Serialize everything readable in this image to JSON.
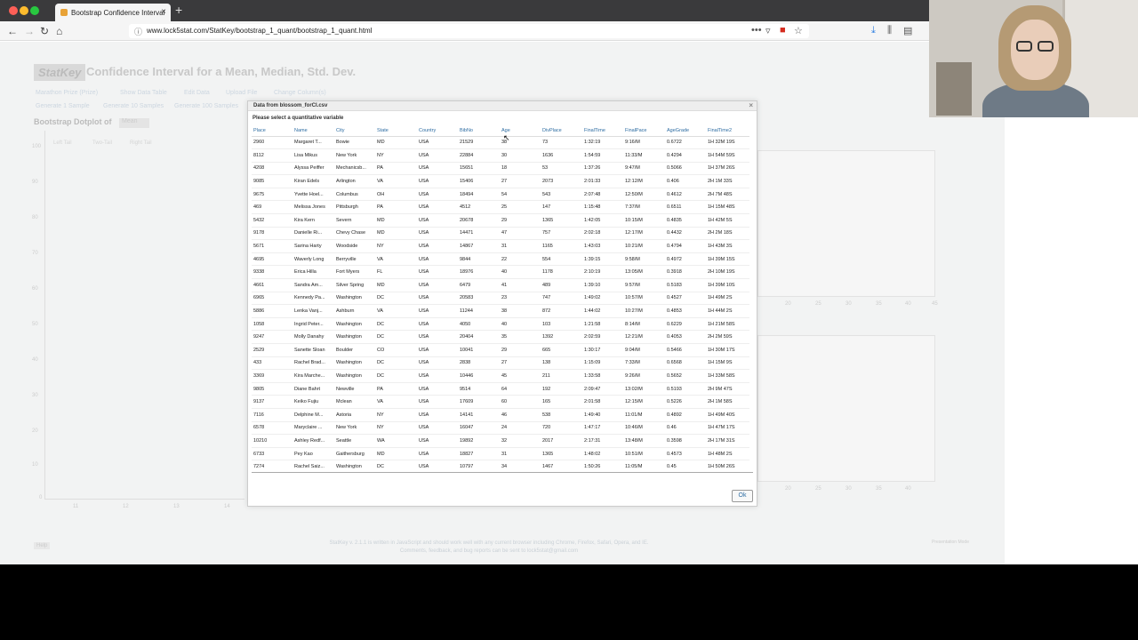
{
  "browser": {
    "tab_title": "Bootstrap Confidence Interval",
    "tab_close": "×",
    "new_tab": "+",
    "url": "www.lock5stat.com/StatKey/bootstrap_1_quant/bootstrap_1_quant.html",
    "icons": [
      "back-arrow-icon",
      "forward-arrow-icon",
      "reload-icon",
      "home-icon",
      "info-icon",
      "more-icon",
      "pocket-icon",
      "flag-icon",
      "star-icon",
      "download-icon",
      "library-icon",
      "sidebar-icon"
    ]
  },
  "page": {
    "logo": "StatKey",
    "title": "Confidence Interval for a Mean, Median, Std. Dev.",
    "menu_row1": [
      "Marathon Prize (Prize)",
      "Show Data Table",
      "Edit Data",
      "Upload File",
      "Change Column(s)"
    ],
    "menu_row2": [
      "Generate 1 Sample",
      "Generate 10 Samples",
      "Generate 100 Samples"
    ],
    "subtitle": "Bootstrap Dotplot of",
    "stat_select": "Mean",
    "radios": [
      "Left Tail",
      "Two-Tail",
      "Right Tail"
    ],
    "y_ticks": [
      "100",
      "90",
      "80",
      "70",
      "60",
      "50",
      "40",
      "30",
      "20",
      "10",
      "0"
    ],
    "x_ticks": [
      "11",
      "12",
      "13",
      "14"
    ],
    "side_x_ticks": [
      "20",
      "25",
      "30",
      "35",
      "40",
      "45"
    ],
    "footer_line1": "StatKey v. 2.1.1 is written in JavaScript and should work well with any current browser including Chrome, Firefox, Safari, Opera, and IE.",
    "footer_line2": "Comments, feedback, and bug reports can be sent to lock5stat@gmail.com",
    "help": "Help",
    "presentation": "Presentation Mode"
  },
  "modal": {
    "title": "Data from blossom_forCI.csv",
    "close": "×",
    "subtitle": "Please select a quantitative variable",
    "ok": "Ok",
    "columns": [
      "Place",
      "Name",
      "City",
      "State",
      "Country",
      "BibNo",
      "Age",
      "DivPlace",
      "FinalTime",
      "FinalPace",
      "AgeGrade",
      "FinalTime2"
    ],
    "rows": [
      [
        "2960",
        "Margaret T...",
        "Bowie",
        "MD",
        "USA",
        "21529",
        "38",
        "73",
        "1:32:19",
        "9:16/M",
        "0.6722",
        "1H 32M 19S"
      ],
      [
        "8112",
        "Lisa Mikus",
        "New York",
        "NY",
        "USA",
        "22884",
        "30",
        "1636",
        "1:54:59",
        "11:33/M",
        "0.4294",
        "1H 54M 59S"
      ],
      [
        "4208",
        "Alyssa Peiffer",
        "Mechanicsb...",
        "PA",
        "USA",
        "15651",
        "18",
        "53",
        "1:37:26",
        "9:47/M",
        "0.5066",
        "1H 37M 26S"
      ],
      [
        "9085",
        "Kiran Edels",
        "Arlington",
        "VA",
        "USA",
        "15406",
        "27",
        "2073",
        "2:01:33",
        "12:12/M",
        "0.406",
        "2H 1M 33S"
      ],
      [
        "9675",
        "Yvette Hoel...",
        "Columbus",
        "OH",
        "USA",
        "18494",
        "54",
        "543",
        "2:07:48",
        "12:50/M",
        "0.4612",
        "2H 7M 48S"
      ],
      [
        "469",
        "Melissa Jones",
        "Pittsburgh",
        "PA",
        "USA",
        "4512",
        "25",
        "147",
        "1:15:48",
        "7:37/M",
        "0.6511",
        "1H 15M 48S"
      ],
      [
        "5432",
        "Kira Kern",
        "Severn",
        "MD",
        "USA",
        "20678",
        "29",
        "1365",
        "1:42:05",
        "10:15/M",
        "0.4835",
        "1H 42M 5S"
      ],
      [
        "9178",
        "Danielle Ri...",
        "Chevy Chase",
        "MD",
        "USA",
        "14471",
        "47",
        "757",
        "2:02:18",
        "12:17/M",
        "0.4432",
        "2H 2M 18S"
      ],
      [
        "5671",
        "Sarina Harty",
        "Woodside",
        "NY",
        "USA",
        "14867",
        "31",
        "1165",
        "1:43:03",
        "10:21/M",
        "0.4794",
        "1H 43M 3S"
      ],
      [
        "4695",
        "Waverly Long",
        "Berryville",
        "VA",
        "USA",
        "9844",
        "22",
        "554",
        "1:39:15",
        "9:58/M",
        "0.4972",
        "1H 39M 15S"
      ],
      [
        "9338",
        "Erica Hilla",
        "Fort Myers",
        "FL",
        "USA",
        "18976",
        "40",
        "1178",
        "2:10:19",
        "13:05/M",
        "0.3918",
        "2H 10M 19S"
      ],
      [
        "4661",
        "Sandra Am...",
        "Silver Spring",
        "MD",
        "USA",
        "6479",
        "41",
        "489",
        "1:39:10",
        "9:57/M",
        "0.5183",
        "1H 39M 10S"
      ],
      [
        "6965",
        "Kennedy Pa...",
        "Washington",
        "DC",
        "USA",
        "20583",
        "23",
        "747",
        "1:49:02",
        "10:57/M",
        "0.4527",
        "1H 49M 2S"
      ],
      [
        "5886",
        "Lenka Vanj...",
        "Ashburn",
        "VA",
        "USA",
        "11244",
        "38",
        "872",
        "1:44:02",
        "10:27/M",
        "0.4853",
        "1H 44M 2S"
      ],
      [
        "1058",
        "Ingrid Peter...",
        "Washington",
        "DC",
        "USA",
        "4050",
        "40",
        "103",
        "1:21:58",
        "8:14/M",
        "0.6229",
        "1H 21M 58S"
      ],
      [
        "9247",
        "Molly Danahy",
        "Washington",
        "DC",
        "USA",
        "20404",
        "35",
        "1392",
        "2:02:59",
        "12:21/M",
        "0.4053",
        "2H 2M 59S"
      ],
      [
        "2529",
        "Sanette Sloan",
        "Boulder",
        "CO",
        "USA",
        "10041",
        "29",
        "665",
        "1:30:17",
        "9:04/M",
        "0.5466",
        "1H 30M 17S"
      ],
      [
        "433",
        "Rachel Brad...",
        "Washington",
        "DC",
        "USA",
        "2838",
        "27",
        "138",
        "1:15:09",
        "7:33/M",
        "0.6568",
        "1H 15M 9S"
      ],
      [
        "3369",
        "Kira Marche...",
        "Washington",
        "DC",
        "USA",
        "10446",
        "45",
        "211",
        "1:33:58",
        "9:26/M",
        "0.5652",
        "1H 33M 58S"
      ],
      [
        "9805",
        "Diane Bahrt",
        "Newville",
        "PA",
        "USA",
        "9514",
        "64",
        "192",
        "2:09:47",
        "13:02/M",
        "0.5193",
        "2H 9M 47S"
      ],
      [
        "9137",
        "Keiko Fujiu",
        "Mclean",
        "VA",
        "USA",
        "17609",
        "60",
        "165",
        "2:01:58",
        "12:15/M",
        "0.5226",
        "2H 1M 58S"
      ],
      [
        "7116",
        "Delphine M...",
        "Astoria",
        "NY",
        "USA",
        "14141",
        "46",
        "538",
        "1:49:40",
        "11:01/M",
        "0.4892",
        "1H 49M 40S"
      ],
      [
        "6578",
        "Maryclaire ...",
        "New York",
        "NY",
        "USA",
        "16047",
        "24",
        "720",
        "1:47:17",
        "10:46/M",
        "0.46",
        "1H 47M 17S"
      ],
      [
        "10210",
        "Ashley Redf...",
        "Seattle",
        "WA",
        "USA",
        "19892",
        "32",
        "2017",
        "2:17:31",
        "13:48/M",
        "0.3598",
        "2H 17M 31S"
      ],
      [
        "6733",
        "Pey Kao",
        "Gaithersburg",
        "MD",
        "USA",
        "18827",
        "31",
        "1365",
        "1:48:02",
        "10:51/M",
        "0.4573",
        "1H 48M 2S"
      ],
      [
        "7274",
        "Rachel Saiz...",
        "Washington",
        "DC",
        "USA",
        "10797",
        "34",
        "1467",
        "1:50:26",
        "11:05/M",
        "0.45",
        "1H 50M 26S"
      ]
    ]
  }
}
